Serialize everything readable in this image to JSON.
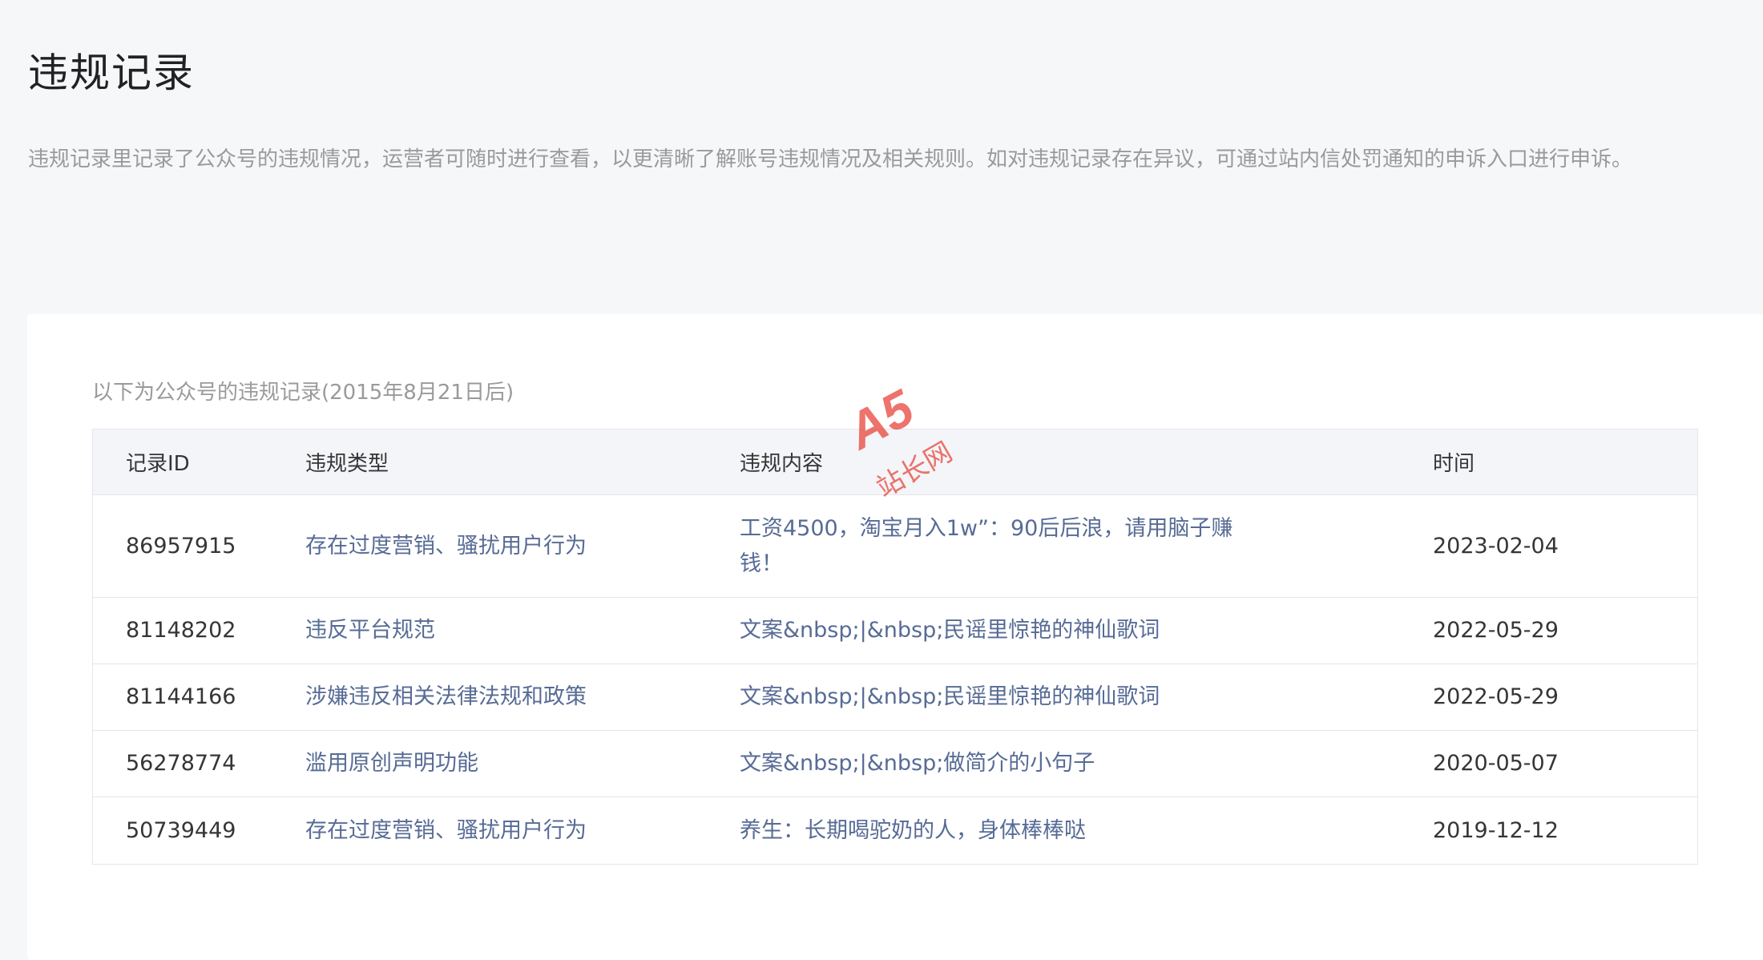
{
  "header": {
    "title": "违规记录",
    "description": "违规记录里记录了公众号的违规情况，运营者可随时进行查看，以更清晰了解账号违规情况及相关规则。如对违规记录存在异议，可通过站内信处罚通知的申诉入口进行申诉。"
  },
  "table": {
    "caption": "以下为公众号的违规记录(2015年8月21日后)",
    "columns": [
      "记录ID",
      "违规类型",
      "违规内容",
      "时间"
    ],
    "rows": [
      {
        "id": "86957915",
        "type": "存在过度营销、骚扰用户行为",
        "content": "工资4500，淘宝月入1w”：90后后浪，请用脑子赚钱！",
        "time": "2023-02-04"
      },
      {
        "id": "81148202",
        "type": "违反平台规范",
        "content": "文案&nbsp;|&nbsp;民谣里惊艳的神仙歌词",
        "time": "2022-05-29"
      },
      {
        "id": "81144166",
        "type": "涉嫌违反相关法律法规和政策",
        "content": "文案&nbsp;|&nbsp;民谣里惊艳的神仙歌词",
        "time": "2022-05-29"
      },
      {
        "id": "56278774",
        "type": "滥用原创声明功能",
        "content": "文案&nbsp;|&nbsp;做简介的小句子",
        "time": "2020-05-07"
      },
      {
        "id": "50739449",
        "type": "存在过度营销、骚扰用户行为",
        "content": "养生：长期喝驼奶的人，身体棒棒哒",
        "time": "2019-12-12"
      }
    ]
  },
  "watermark": {
    "logo": "A5",
    "subtitle": "站长网"
  },
  "colors": {
    "link": "#576b95",
    "muted": "#9a9a9a",
    "watermark": "#e8453c"
  }
}
